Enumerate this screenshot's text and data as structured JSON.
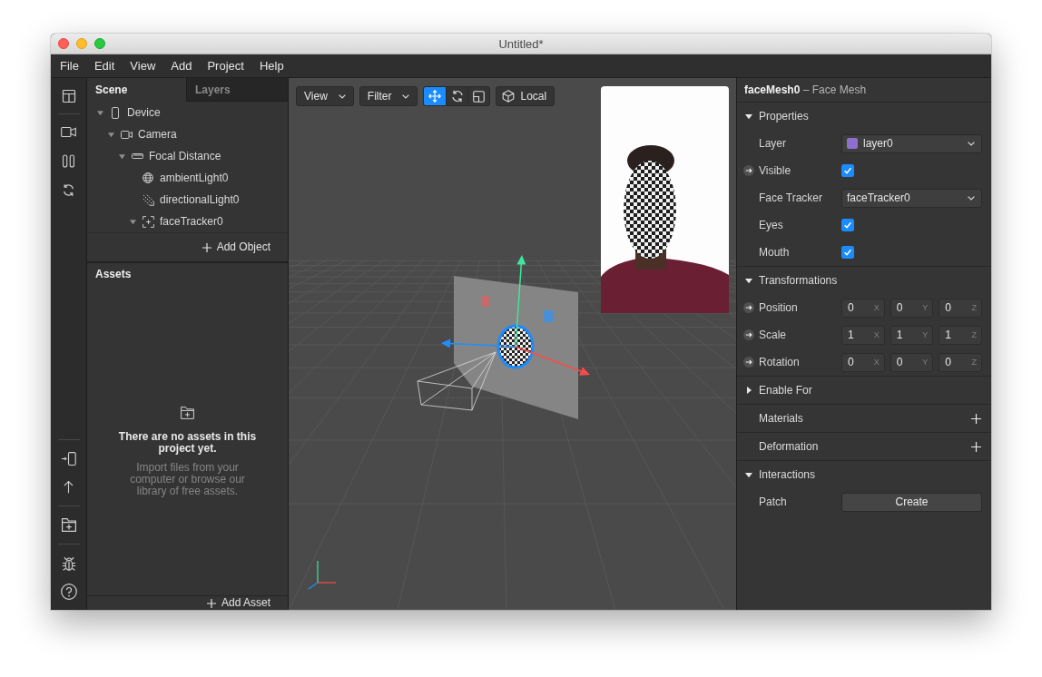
{
  "window": {
    "title": "Untitled*"
  },
  "menu": [
    "File",
    "Edit",
    "View",
    "Add",
    "Project",
    "Help"
  ],
  "scene_panel": {
    "tabs": [
      {
        "label": "Scene",
        "selected": true
      },
      {
        "label": "Layers",
        "selected": false
      }
    ],
    "tree": [
      {
        "label": "Device",
        "kind": "device",
        "expanded": true,
        "children": [
          {
            "label": "Camera",
            "kind": "camera",
            "expanded": true,
            "children": [
              {
                "label": "Focal Distance",
                "kind": "focal-distance",
                "expanded": true,
                "children": [
                  {
                    "label": "ambientLight0",
                    "kind": "ambient-light"
                  },
                  {
                    "label": "directionalLight0",
                    "kind": "directional-light"
                  },
                  {
                    "label": "faceTracker0",
                    "kind": "face-tracker",
                    "expanded": true
                  }
                ]
              }
            ]
          }
        ]
      }
    ],
    "add_button": "Add Object"
  },
  "assets_panel": {
    "title": "Assets",
    "empty_title": "There are no assets in this project yet.",
    "empty_text": "Import files from your computer or browse our library of free assets.",
    "add_button": "Add Asset"
  },
  "viewport": {
    "toolbar": [
      {
        "label": "View",
        "kind": "dropdown"
      },
      {
        "label": "Filter",
        "kind": "dropdown"
      }
    ],
    "transform_tools": [
      {
        "kind": "move",
        "selected": true
      },
      {
        "kind": "rotate",
        "selected": false
      },
      {
        "kind": "scale",
        "selected": false
      }
    ],
    "space_button": "Local"
  },
  "inspector": {
    "title": "**faceMesh0** – Face Mesh",
    "sections": [
      {
        "title": "Properties",
        "kind": "collapsible",
        "expanded": true,
        "rows": [
          {
            "kind": "dropdown",
            "label": "Layer",
            "linked": false,
            "value": "layer0",
            "color": "#8e70cc"
          },
          {
            "kind": "checkbox",
            "label": "Visible",
            "linked": true,
            "checked": true
          },
          {
            "kind": "dropdown",
            "label": "Face Tracker",
            "linked": false,
            "value": "faceTracker0"
          },
          {
            "kind": "checkbox",
            "label": "Eyes",
            "linked": false,
            "checked": true
          },
          {
            "kind": "checkbox",
            "label": "Mouth",
            "linked": false,
            "checked": true
          }
        ]
      },
      {
        "title": "Transformations",
        "kind": "collapsible",
        "expanded": true,
        "rows": [
          {
            "kind": "vector",
            "label": "Position",
            "linked": true,
            "fields": [
              {
                "value": "0",
                "axis": "X"
              },
              {
                "value": "0",
                "axis": "Y"
              },
              {
                "value": "0",
                "axis": "Z"
              }
            ]
          },
          {
            "kind": "vector",
            "label": "Scale",
            "linked": true,
            "fields": [
              {
                "value": "1",
                "axis": "X"
              },
              {
                "value": "1",
                "axis": "Y"
              },
              {
                "value": "1",
                "axis": "Z"
              }
            ]
          },
          {
            "kind": "vector",
            "label": "Rotation",
            "linked": true,
            "fields": [
              {
                "value": "0",
                "axis": "X"
              },
              {
                "value": "0",
                "axis": "Y"
              },
              {
                "value": "0",
                "axis": "Z"
              }
            ]
          }
        ]
      },
      {
        "title": "Enable For",
        "kind": "collapsible",
        "expanded": false
      },
      {
        "title": "Materials",
        "kind": "addable"
      },
      {
        "title": "Deformation",
        "kind": "addable"
      },
      {
        "title": "Interactions",
        "kind": "collapsible",
        "expanded": true,
        "rows": [
          {
            "kind": "button",
            "label": "Patch",
            "linked": false,
            "value": "Create"
          }
        ]
      }
    ]
  }
}
